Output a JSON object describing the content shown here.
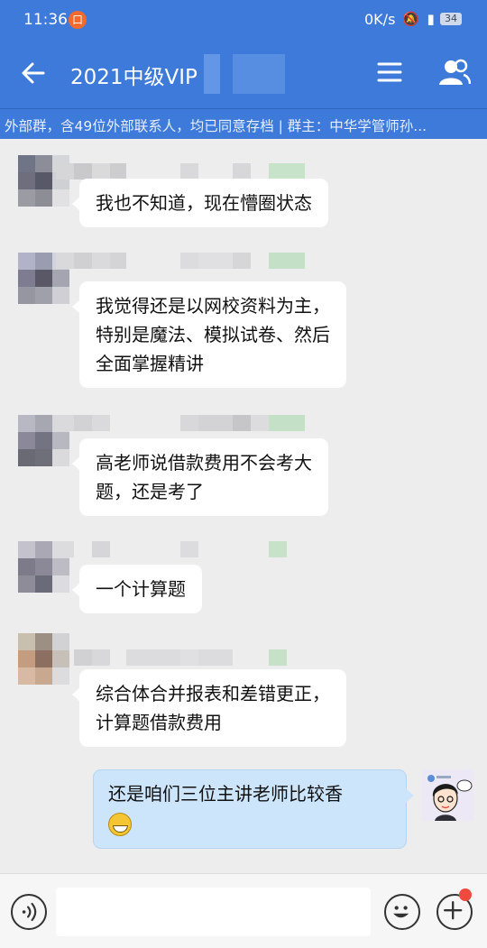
{
  "status_bar": {
    "time": "11:36",
    "notification_glyph": "口",
    "network_speed": "0K/s",
    "signal_icons": "🔕 ▮",
    "battery": "34"
  },
  "header": {
    "title": "2021中级VIP",
    "subtitle": "外部群，含49位外部联系人，均已同意存档 | 群主：中华学管师孙..."
  },
  "messages": [
    {
      "side": "left",
      "lines": [
        "我也不知道，现在懵圈状态"
      ]
    },
    {
      "side": "left",
      "lines": [
        "我觉得还是以网校资料为主，",
        "特别是魔法、模拟试卷、然后",
        "全面掌握精讲"
      ]
    },
    {
      "side": "left",
      "lines": [
        "高老师说借款费用不会考大",
        "题，还是考了"
      ]
    },
    {
      "side": "left",
      "lines": [
        "一个计算题"
      ]
    },
    {
      "side": "left",
      "lines": [
        "综合体合并报表和差错更正，",
        "计算题借款费用"
      ]
    },
    {
      "side": "right",
      "lines": [
        "还是咱们三位主讲老师比较香"
      ],
      "emoji": "grinning-face"
    }
  ],
  "colors": {
    "header_bg": "#3d7ad9",
    "chat_bg": "#ededed",
    "my_bubble": "#cde5fb",
    "badge_red": "#f04a3f"
  },
  "icons": [
    "back-arrow-icon",
    "menu-icon",
    "members-icon",
    "voice-icon",
    "emoji-icon",
    "plus-icon"
  ]
}
